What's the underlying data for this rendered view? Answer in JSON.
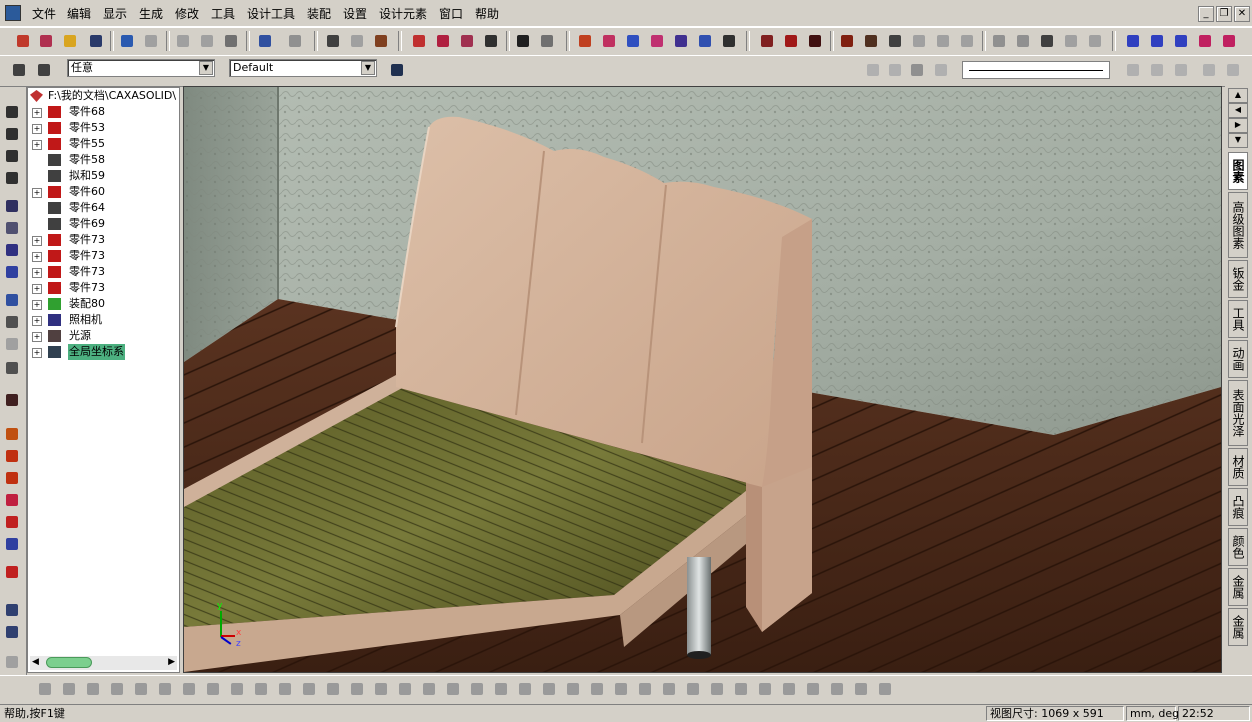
{
  "menu": {
    "items": [
      "文件",
      "编辑",
      "显示",
      "生成",
      "修改",
      "工具",
      "设计工具",
      "装配",
      "设置",
      "设计元素",
      "窗口",
      "帮助"
    ]
  },
  "window_controls": [
    "_",
    "❐",
    "✕"
  ],
  "toolbar2": {
    "filter_combo": "任意",
    "style_combo": "Default"
  },
  "tree": {
    "root": "F:\\我的文档\\CAXASOLID\\",
    "items": [
      {
        "label": "零件68",
        "icon": "part-icon",
        "expandable": true
      },
      {
        "label": "零件53",
        "icon": "part-icon",
        "expandable": true
      },
      {
        "label": "零件55",
        "icon": "part-icon",
        "expandable": true
      },
      {
        "label": "零件58",
        "icon": "curve-icon",
        "expandable": false
      },
      {
        "label": "拟和59",
        "icon": "curve-icon",
        "expandable": false
      },
      {
        "label": "零件60",
        "icon": "part-icon",
        "expandable": true
      },
      {
        "label": "零件64",
        "icon": "curve-icon",
        "expandable": false
      },
      {
        "label": "零件69",
        "icon": "curve-icon",
        "expandable": false
      },
      {
        "label": "零件73",
        "icon": "part-icon",
        "expandable": true
      },
      {
        "label": "零件73",
        "icon": "part-icon",
        "expandable": true
      },
      {
        "label": "零件73",
        "icon": "part-icon",
        "expandable": true
      },
      {
        "label": "零件73",
        "icon": "part-icon",
        "expandable": true
      },
      {
        "label": "装配80",
        "icon": "assembly-icon",
        "expandable": true
      },
      {
        "label": "照相机",
        "icon": "camera-icon",
        "expandable": true
      },
      {
        "label": "光源",
        "icon": "light-icon",
        "expandable": true
      },
      {
        "label": "全局坐标系",
        "icon": "axis-icon",
        "expandable": true,
        "selected": true
      }
    ]
  },
  "right_tabs": [
    "图素",
    "高级图素",
    "钣金",
    "工具",
    "动画",
    "表面光泽",
    "材质",
    "凸痕",
    "颜色",
    "金属",
    "金属"
  ],
  "axis": {
    "x": "x",
    "y": "y",
    "z": "z"
  },
  "status": {
    "help": "帮助,按F1键",
    "view_size": "视图尺寸: 1069 x 591",
    "units": "mm, deg",
    "time": "22:52"
  },
  "colors": {
    "tree_selection": "#4cb080",
    "wall": "#9aa49a",
    "floor": "#4a2a18",
    "headboard": "#d7b59c",
    "slats": "#6b6a2e"
  }
}
